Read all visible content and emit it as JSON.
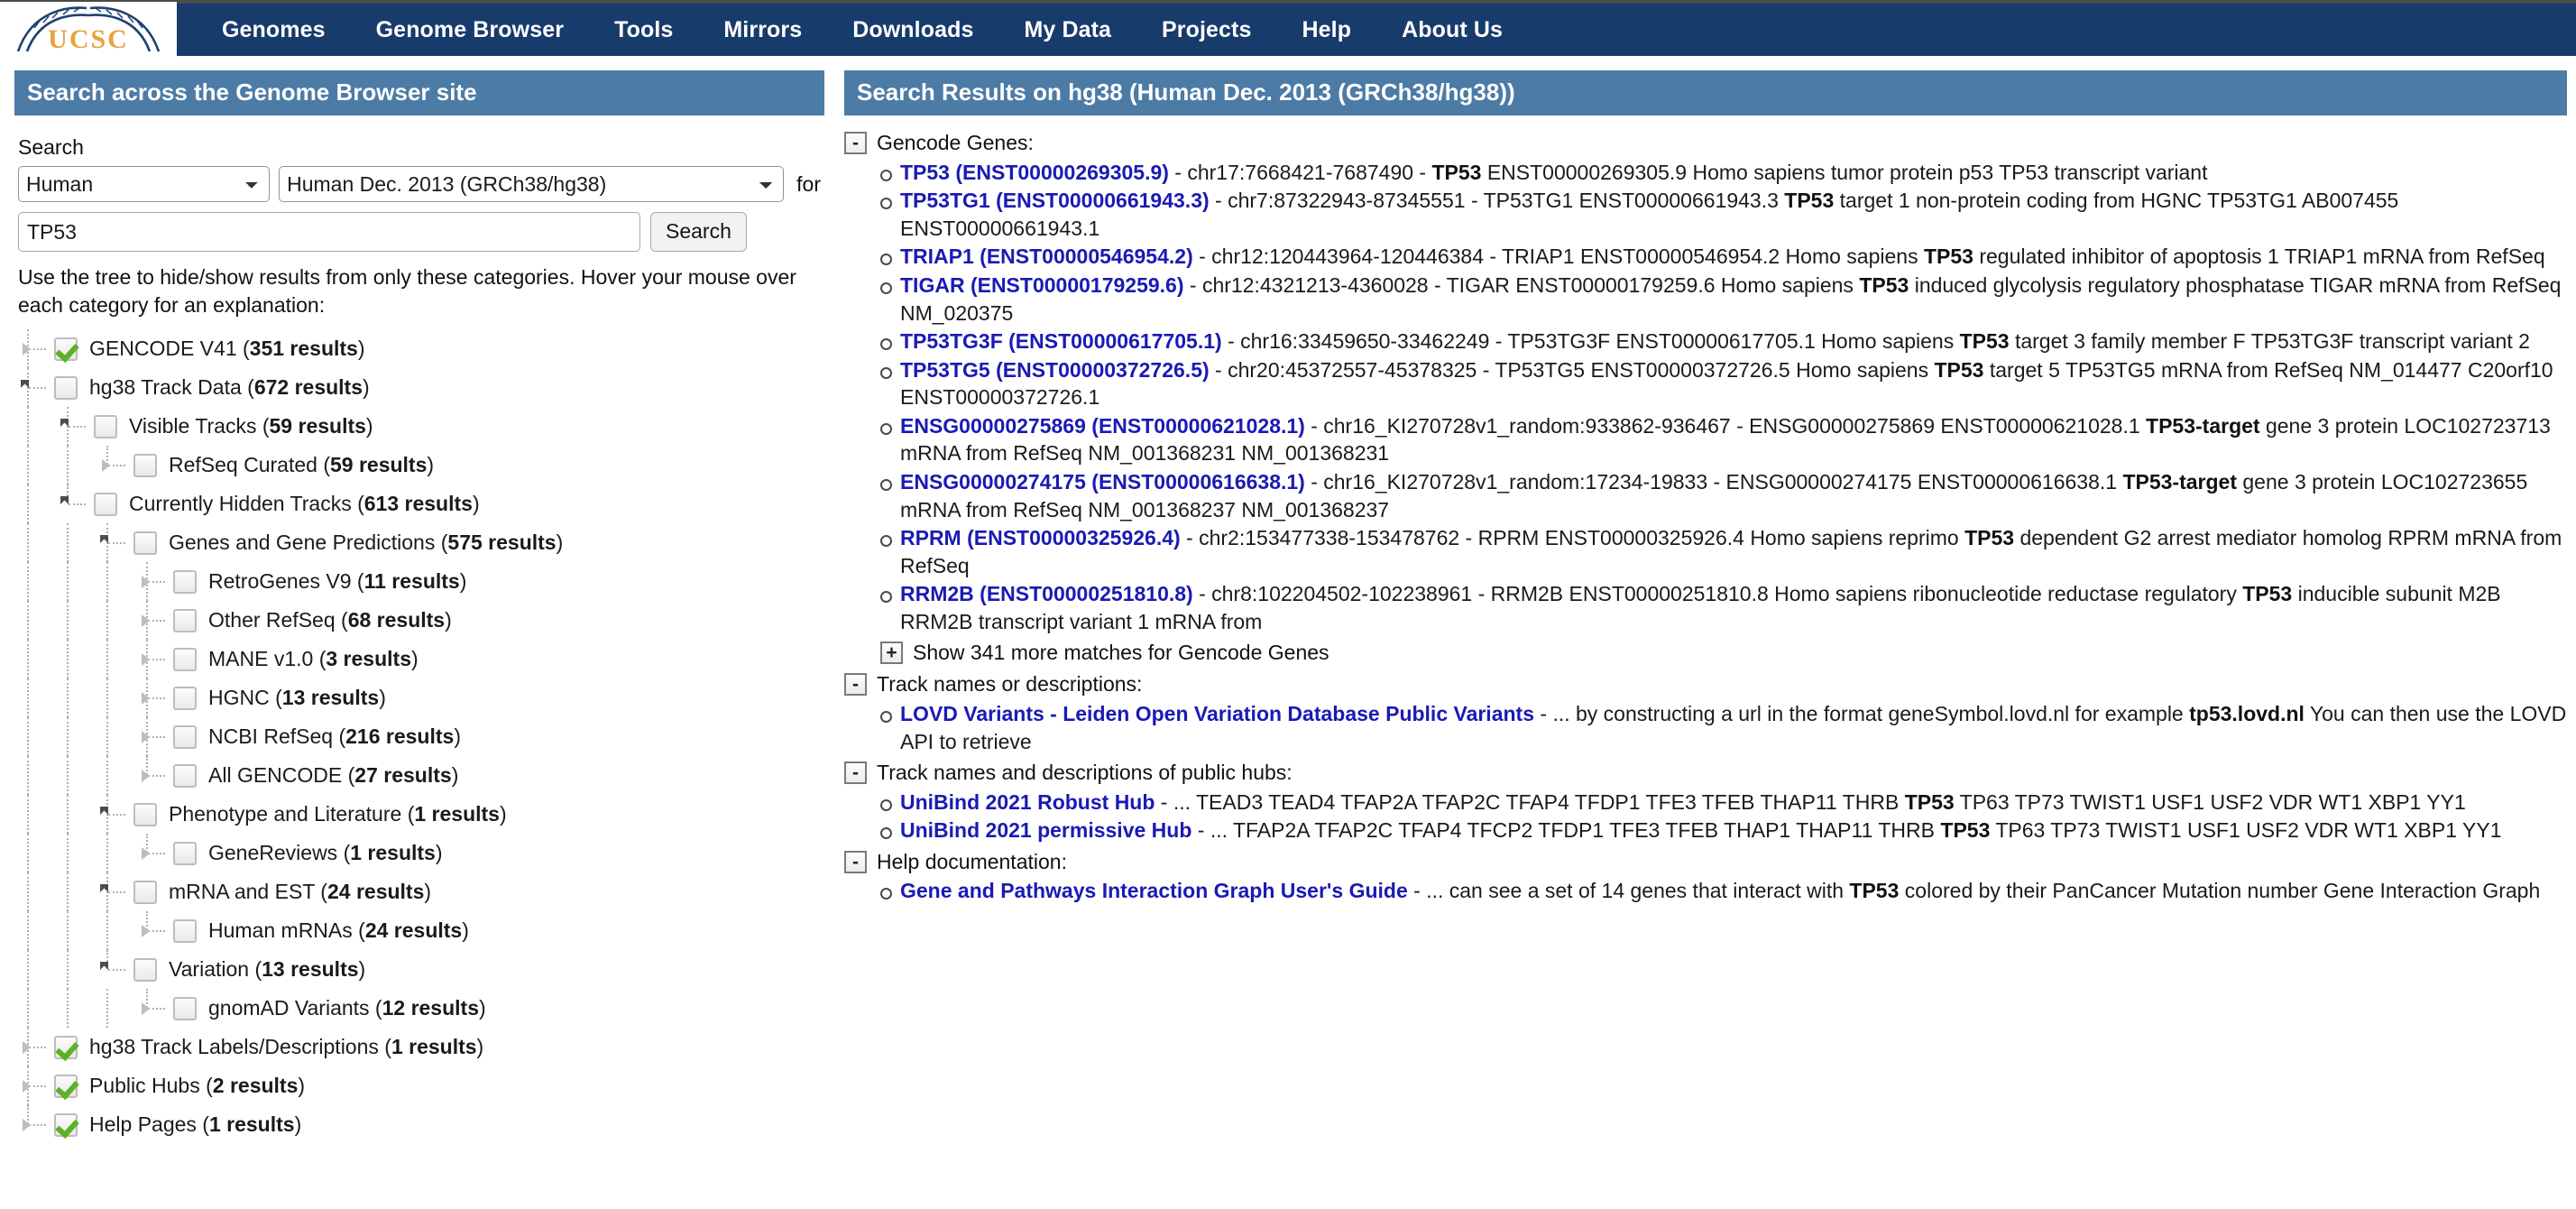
{
  "nav": {
    "logo_text": "UCSC",
    "items": [
      {
        "label": "Genomes"
      },
      {
        "label": "Genome Browser"
      },
      {
        "label": "Tools"
      },
      {
        "label": "Mirrors"
      },
      {
        "label": "Downloads"
      },
      {
        "label": "My Data"
      },
      {
        "label": "Projects"
      },
      {
        "label": "Help"
      },
      {
        "label": "About Us"
      }
    ]
  },
  "colors": {
    "nav_bg": "#173b6b",
    "panel_header_bg": "#4c7ba6",
    "link": "#1a1ab4",
    "check_green": "#5bb226"
  },
  "left_panel": {
    "title": "Search across the Genome Browser site",
    "search_label": "Search",
    "organism_value": "Human",
    "assembly_value": "Human Dec. 2013 (GRCh38/hg38)",
    "for_label": "for",
    "query_value": "TP53",
    "query_placeholder": "",
    "search_button": "Search",
    "hint": "Use the tree to hide/show results from only these categories. Hover your mouse over each category for an explanation:",
    "tree": [
      {
        "depth": 0,
        "checked": true,
        "kind": "leaf",
        "label": "GENCODE V41",
        "count": "351 results"
      },
      {
        "depth": 0,
        "checked": false,
        "kind": "open",
        "label": "hg38 Track Data",
        "count": "672 results"
      },
      {
        "depth": 1,
        "checked": false,
        "kind": "open",
        "label": "Visible Tracks",
        "count": "59 results"
      },
      {
        "depth": 2,
        "checked": false,
        "kind": "leaf",
        "label": "RefSeq Curated",
        "count": "59 results"
      },
      {
        "depth": 1,
        "checked": false,
        "kind": "open",
        "label": "Currently Hidden Tracks",
        "count": "613 results"
      },
      {
        "depth": 2,
        "checked": false,
        "kind": "open",
        "label": "Genes and Gene Predictions",
        "count": "575 results"
      },
      {
        "depth": 3,
        "checked": false,
        "kind": "leaf",
        "label": "RetroGenes V9",
        "count": "11 results"
      },
      {
        "depth": 3,
        "checked": false,
        "kind": "leaf",
        "label": "Other RefSeq",
        "count": "68 results"
      },
      {
        "depth": 3,
        "checked": false,
        "kind": "leaf",
        "label": "MANE v1.0",
        "count": "3 results"
      },
      {
        "depth": 3,
        "checked": false,
        "kind": "leaf",
        "label": "HGNC",
        "count": "13 results"
      },
      {
        "depth": 3,
        "checked": false,
        "kind": "leaf",
        "label": "NCBI RefSeq",
        "count": "216 results"
      },
      {
        "depth": 3,
        "checked": false,
        "kind": "leaf",
        "label": "All GENCODE",
        "count": "27 results"
      },
      {
        "depth": 2,
        "checked": false,
        "kind": "open",
        "label": "Phenotype and Literature",
        "count": "1 results"
      },
      {
        "depth": 3,
        "checked": false,
        "kind": "leaf",
        "label": "GeneReviews",
        "count": "1 results"
      },
      {
        "depth": 2,
        "checked": false,
        "kind": "open",
        "label": "mRNA and EST",
        "count": "24 results"
      },
      {
        "depth": 3,
        "checked": false,
        "kind": "leaf",
        "label": "Human mRNAs",
        "count": "24 results"
      },
      {
        "depth": 2,
        "checked": false,
        "kind": "open",
        "label": "Variation",
        "count": "13 results"
      },
      {
        "depth": 3,
        "checked": false,
        "kind": "leaf",
        "label": "gnomAD Variants",
        "count": "12 results"
      },
      {
        "depth": 0,
        "checked": true,
        "kind": "leaf",
        "label": "hg38 Track Labels/Descriptions",
        "count": "1 results"
      },
      {
        "depth": 0,
        "checked": true,
        "kind": "leaf",
        "label": "Public Hubs",
        "count": "2 results"
      },
      {
        "depth": 0,
        "checked": true,
        "kind": "leaf",
        "label": "Help Pages",
        "count": "1 results"
      }
    ]
  },
  "right_panel": {
    "title": "Search Results on hg38 (Human Dec. 2013 (GRCh38/hg38))",
    "collapse_glyph": "-",
    "expand_glyph": "+",
    "groups": [
      {
        "heading": "Gencode Genes:",
        "items": [
          {
            "link": "TP53 (ENST00000269305.9)",
            "parts": [
              {
                "t": " - chr17:7668421-7687490 - ",
                "hl": false
              },
              {
                "t": "TP53",
                "hl": true
              },
              {
                "t": " ENST00000269305.9 Homo sapiens tumor protein p53 TP53 transcript variant",
                "hl": false
              }
            ]
          },
          {
            "link": "TP53TG1 (ENST00000661943.3)",
            "parts": [
              {
                "t": " - chr7:87322943-87345551 - TP53TG1 ENST00000661943.3 ",
                "hl": false
              },
              {
                "t": "TP53",
                "hl": true
              },
              {
                "t": " target 1 non-protein coding from HGNC TP53TG1 AB007455 ENST00000661943.1",
                "hl": false
              }
            ]
          },
          {
            "link": "TRIAP1 (ENST00000546954.2)",
            "parts": [
              {
                "t": " - chr12:120443964-120446384 - TRIAP1 ENST00000546954.2 Homo sapiens ",
                "hl": false
              },
              {
                "t": "TP53",
                "hl": true
              },
              {
                "t": " regulated inhibitor of apoptosis 1 TRIAP1 mRNA from RefSeq",
                "hl": false
              }
            ]
          },
          {
            "link": "TIGAR (ENST00000179259.6)",
            "parts": [
              {
                "t": " - chr12:4321213-4360028 - TIGAR ENST00000179259.6 Homo sapiens ",
                "hl": false
              },
              {
                "t": "TP53",
                "hl": true
              },
              {
                "t": " induced glycolysis regulatory phosphatase TIGAR mRNA from RefSeq NM_020375",
                "hl": false
              }
            ]
          },
          {
            "link": "TP53TG3F (ENST00000617705.1)",
            "parts": [
              {
                "t": " - chr16:33459650-33462249 - TP53TG3F ENST00000617705.1 Homo sapiens ",
                "hl": false
              },
              {
                "t": "TP53",
                "hl": true
              },
              {
                "t": " target 3 family member F TP53TG3F transcript variant 2",
                "hl": false
              }
            ]
          },
          {
            "link": "TP53TG5 (ENST00000372726.5)",
            "parts": [
              {
                "t": " - chr20:45372557-45378325 - TP53TG5 ENST00000372726.5 Homo sapiens ",
                "hl": false
              },
              {
                "t": "TP53",
                "hl": true
              },
              {
                "t": " target 5 TP53TG5 mRNA from RefSeq NM_014477 C20orf10 ENST00000372726.1",
                "hl": false
              }
            ]
          },
          {
            "link": "ENSG00000275869 (ENST00000621028.1)",
            "parts": [
              {
                "t": " - chr16_KI270728v1_random:933862-936467 - ENSG00000275869 ENST00000621028.1 ",
                "hl": false
              },
              {
                "t": "TP53-target",
                "hl": true
              },
              {
                "t": " gene 3 protein LOC102723713 mRNA from RefSeq NM_001368231 NM_001368231",
                "hl": false
              }
            ]
          },
          {
            "link": "ENSG00000274175 (ENST00000616638.1)",
            "parts": [
              {
                "t": " - chr16_KI270728v1_random:17234-19833 - ENSG00000274175 ENST00000616638.1 ",
                "hl": false
              },
              {
                "t": "TP53-target",
                "hl": true
              },
              {
                "t": " gene 3 protein LOC102723655 mRNA from RefSeq NM_001368237 NM_001368237",
                "hl": false
              }
            ]
          },
          {
            "link": "RPRM (ENST00000325926.4)",
            "parts": [
              {
                "t": " - chr2:153477338-153478762 - RPRM ENST00000325926.4 Homo sapiens reprimo ",
                "hl": false
              },
              {
                "t": "TP53",
                "hl": true
              },
              {
                "t": " dependent G2 arrest mediator homolog RPRM mRNA from RefSeq",
                "hl": false
              }
            ]
          },
          {
            "link": "RRM2B (ENST00000251810.8)",
            "parts": [
              {
                "t": " - chr8:102204502-102238961 - RRM2B ENST00000251810.8 Homo sapiens ribonucleotide reductase regulatory ",
                "hl": false
              },
              {
                "t": "TP53",
                "hl": true
              },
              {
                "t": " inducible subunit M2B RRM2B transcript variant 1 mRNA from",
                "hl": false
              }
            ]
          }
        ],
        "more_label": "Show 341 more matches for Gencode Genes"
      },
      {
        "heading": "Track names or descriptions:",
        "items": [
          {
            "link": "LOVD Variants - Leiden Open Variation Database Public Variants",
            "parts": [
              {
                "t": " - ... by constructing a url in the format geneSymbol.lovd.nl for example ",
                "hl": false
              },
              {
                "t": "tp53.lovd.nl",
                "hl": true
              },
              {
                "t": " You can then use the LOVD API to retrieve",
                "hl": false
              }
            ]
          }
        ],
        "more_label": ""
      },
      {
        "heading": "Track names and descriptions of public hubs:",
        "items": [
          {
            "link": "UniBind 2021 Robust Hub",
            "parts": [
              {
                "t": " - ... TEAD3 TEAD4 TFAP2A TFAP2C TFAP4 TFDP1 TFE3 TFEB THAP11 THRB ",
                "hl": false
              },
              {
                "t": "TP53",
                "hl": true
              },
              {
                "t": " TP63 TP73 TWIST1 USF1 USF2 VDR WT1 XBP1 YY1",
                "hl": false
              }
            ]
          },
          {
            "link": "UniBind 2021 permissive Hub",
            "parts": [
              {
                "t": " - ... TFAP2A TFAP2C TFAP4 TFCP2 TFDP1 TFE3 TFEB THAP1 THAP11 THRB ",
                "hl": false
              },
              {
                "t": "TP53",
                "hl": true
              },
              {
                "t": " TP63 TP73 TWIST1 USF1 USF2 VDR WT1 XBP1 YY1",
                "hl": false
              }
            ]
          }
        ],
        "more_label": ""
      },
      {
        "heading": "Help documentation:",
        "items": [
          {
            "link": "Gene and Pathways Interaction Graph User's Guide",
            "parts": [
              {
                "t": " - ... can see a set of 14 genes that interact with ",
                "hl": false
              },
              {
                "t": "TP53",
                "hl": true
              },
              {
                "t": " colored by their PanCancer Mutation number Gene Interaction Graph",
                "hl": false
              }
            ]
          }
        ],
        "more_label": ""
      }
    ]
  }
}
